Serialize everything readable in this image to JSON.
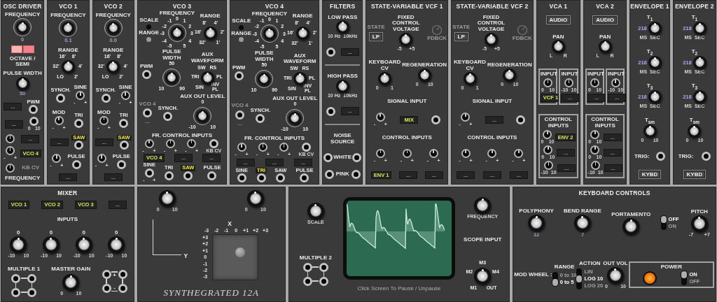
{
  "top_row": [
    {
      "kind": "rack",
      "title": "OSC DRIVER",
      "rows": [
        {
          "items": [
            {
              "kind": "dial",
              "label": "FREQUENCY",
              "value": "0"
            }
          ]
        },
        {
          "items": [
            {
              "kind": "pink"
            }
          ]
        },
        {
          "items": [
            {
              "kind": "text",
              "text": "OCTAVE / SEMI"
            }
          ]
        },
        {
          "items": [
            {
              "kind": "knob",
              "label": "PULSE WIDTH",
              "value": "50"
            }
          ]
        },
        {
          "items": [
            {
              "kind": "tag",
              "text": "...",
              "lit": false
            },
            {
              "kind": "jack",
              "label": "PWM"
            }
          ]
        },
        {
          "items": [
            {
              "kind": "tag",
              "text": "...",
              "lit": false
            },
            {
              "kind": "jack",
              "marks": [
                "0",
                "10"
              ]
            }
          ]
        },
        {
          "items": [
            {
              "kind": "trim"
            },
            {
              "kind": "tag",
              "text": "...",
              "lit": false
            }
          ]
        },
        {
          "items": [
            {
              "kind": "trim",
              "marks": [
                "-",
                "+"
              ]
            },
            {
              "kind": "tag",
              "text": "VCO 4",
              "lit": true
            }
          ]
        },
        {
          "items": [
            {
              "kind": "trim"
            },
            {
              "kind": "text",
              "text": "KB CV",
              "dim": true
            }
          ]
        },
        {
          "items": [
            {
              "kind": "text",
              "text": "FREQUENCY"
            }
          ]
        }
      ]
    },
    {
      "kind": "rack",
      "title": "VCO 1",
      "rows": [
        {
          "items": [
            {
              "kind": "dial",
              "label": "FREQUENCY",
              "value": "0.1"
            }
          ]
        },
        {
          "items": [
            {
              "kind": "knob",
              "label": "RANGE",
              "scale": [
                "LO",
                "32'",
                "16'",
                "8'",
                "4'",
                "2'"
              ]
            }
          ]
        },
        {
          "items": [
            {
              "kind": "jack",
              "label": "SYNCH."
            },
            {
              "kind": "trim",
              "label": "SINE",
              "marks": [
                "-",
                "+"
              ]
            }
          ]
        },
        {
          "items": [
            {
              "kind": "trim",
              "label": "MOD",
              "marks": [
                "-",
                "+"
              ]
            },
            {
              "kind": "jack",
              "label": "TRI"
            }
          ]
        },
        {
          "items": [
            {
              "kind": "tag",
              "text": "...",
              "lit": false
            },
            {
              "kind": "jack",
              "label": "SAW",
              "lit": true
            }
          ]
        },
        {
          "items": [
            {
              "kind": "trim",
              "marks": [
                "-",
                "+"
              ]
            },
            {
              "kind": "jack",
              "label": "PULSE"
            }
          ]
        },
        {
          "items": [
            {
              "kind": "tag",
              "text": "...",
              "lit": false
            }
          ]
        }
      ]
    },
    {
      "kind": "rack",
      "title": "VCO 2",
      "rows": [
        {
          "items": [
            {
              "kind": "dial",
              "label": "FREQUENCY",
              "value": "0.0"
            }
          ]
        },
        {
          "items": [
            {
              "kind": "knob",
              "label": "RANGE",
              "scale": [
                "LO",
                "32'",
                "16'",
                "8'",
                "4'",
                "2'"
              ]
            }
          ]
        },
        {
          "items": [
            {
              "kind": "jack",
              "label": "SYNCH."
            },
            {
              "kind": "trim",
              "label": "SINE",
              "marks": [
                "-",
                "+"
              ]
            }
          ]
        },
        {
          "items": [
            {
              "kind": "trim",
              "label": "MOD",
              "marks": [
                "-",
                "+"
              ]
            },
            {
              "kind": "jack",
              "label": "TRI"
            }
          ]
        },
        {
          "items": [
            {
              "kind": "tag",
              "text": "...",
              "lit": false
            },
            {
              "kind": "jack",
              "label": "SAW",
              "lit": true
            }
          ]
        },
        {
          "items": [
            {
              "kind": "trim",
              "marks": [
                "-",
                "+"
              ]
            },
            {
              "kind": "jack",
              "label": "PULSE"
            }
          ]
        },
        {
          "items": [
            {
              "kind": "tag",
              "text": "...",
              "lit": false
            }
          ]
        }
      ]
    },
    {
      "kind": "rack",
      "title": "VCO 3",
      "rows": [
        {
          "items": [
            {
              "kind": "selector",
              "options": [
                {
                  "label": "SCALE",
                  "selected": false
                },
                {
                  "label": "RANGE",
                  "selected": true
                }
              ]
            },
            {
              "kind": "centerdial",
              "label": "FREQUENCY",
              "scale": [
                "0",
                "1",
                "2",
                "3",
                "4",
                "5",
                "-1",
                "-2",
                "-3",
                "-4",
                "-5"
              ]
            },
            {
              "kind": "knob",
              "label": "RANGE",
              "scale": [
                "32'",
                "16'",
                "8'",
                "4'",
                "2'",
                "1'"
              ]
            }
          ]
        },
        {
          "items": [
            {
              "kind": "jack",
              "label": "PWM"
            },
            {
              "kind": "dial",
              "label": "PULSE WIDTH",
              "scale": [
                "10",
                "50",
                "90"
              ]
            },
            {
              "kind": "knob",
              "label": "AUX WAVEFORM",
              "scale": [
                "SIN",
                "TRI",
                "SW",
                "RS",
                "PL",
                "INV PL"
              ]
            }
          ]
        },
        {
          "items": [
            {
              "kind": "stack",
              "items": [
                {
                  "kind": "text",
                  "text": "VCO 4",
                  "dim": true
                },
                {
                  "kind": "jack"
                },
                {
                  "kind": "text",
                  "text": "...",
                  "dim": true
                }
              ]
            },
            {
              "kind": "jack",
              "label": "SYNCH."
            },
            {
              "kind": "dial",
              "label": "AUX OUT LEVEL",
              "scale": [
                "-10",
                "0",
                "10"
              ]
            }
          ]
        },
        {
          "items": [
            {
              "kind": "text",
              "text": "FR. CONTROL INPUTS"
            }
          ]
        },
        {
          "items": [
            {
              "kind": "trim",
              "marks": [
                "-",
                "+"
              ]
            },
            {
              "kind": "trim",
              "marks": [
                "-",
                "+"
              ]
            },
            {
              "kind": "trim",
              "marks": [
                "-",
                "+"
              ]
            },
            {
              "kind": "jack",
              "marks": [
                "KB CV"
              ]
            }
          ]
        },
        {
          "items": [
            {
              "kind": "tag",
              "text": "VCO 4",
              "lit": true
            },
            {
              "kind": "tag",
              "text": "...",
              "lit": false
            },
            {
              "kind": "tag",
              "text": "...",
              "lit": false
            }
          ]
        },
        {
          "items": [
            {
              "kind": "jack",
              "label": "SINE",
              "marks": [
                "-",
                "+"
              ]
            },
            {
              "kind": "jack",
              "label": "TRI"
            },
            {
              "kind": "jack",
              "label": "SAW",
              "lit": true
            },
            {
              "kind": "jack",
              "label": "PULSE"
            }
          ]
        }
      ]
    },
    {
      "kind": "rack",
      "title": "VCO 4",
      "rows": [
        {
          "items": [
            {
              "kind": "selector",
              "options": [
                {
                  "label": "SCALE",
                  "selected": false
                },
                {
                  "label": "RANGE",
                  "selected": true
                }
              ]
            },
            {
              "kind": "centerdial",
              "label": "FREQUENCY",
              "scale": [
                "0",
                "1",
                "2",
                "3",
                "4",
                "5",
                "-1",
                "-2",
                "-3",
                "-4",
                "-5"
              ]
            },
            {
              "kind": "knob",
              "label": "RANGE",
              "scale": [
                "32'",
                "16'",
                "8'",
                "4'",
                "2'",
                "1'"
              ]
            }
          ]
        },
        {
          "items": [
            {
              "kind": "jack",
              "label": "PWM"
            },
            {
              "kind": "dial",
              "label": "PULSE WIDTH",
              "scale": [
                "10",
                "50",
                "90"
              ]
            },
            {
              "kind": "knob",
              "label": "AUX WAVEFORM",
              "scale": [
                "SIN",
                "TRI",
                "SW",
                "RS",
                "PL",
                "INV PL"
              ]
            }
          ]
        },
        {
          "items": [
            {
              "kind": "stack",
              "items": [
                {
                  "kind": "text",
                  "text": "VCO 4",
                  "dim": true
                },
                {
                  "kind": "jack"
                },
                {
                  "kind": "text",
                  "text": "...",
                  "dim": true
                }
              ]
            },
            {
              "kind": "jack",
              "label": "SYNCH."
            },
            {
              "kind": "dial",
              "label": "AUX OUT LEVEL",
              "scale": [
                "-10",
                "0",
                "10"
              ]
            }
          ]
        },
        {
          "items": [
            {
              "kind": "text",
              "text": "FR. CONTROL INPUTS"
            }
          ]
        },
        {
          "items": [
            {
              "kind": "trim",
              "marks": [
                "-",
                "+"
              ]
            },
            {
              "kind": "trim",
              "marks": [
                "-",
                "+"
              ]
            },
            {
              "kind": "trim",
              "marks": [
                "-",
                "+"
              ]
            },
            {
              "kind": "jack",
              "marks": [
                "KB CV"
              ]
            }
          ]
        },
        {
          "items": [
            {
              "kind": "tag",
              "text": "...",
              "lit": false
            },
            {
              "kind": "tag",
              "text": "...",
              "lit": false
            },
            {
              "kind": "tag",
              "text": "...",
              "lit": false
            }
          ]
        },
        {
          "items": [
            {
              "kind": "jack",
              "label": "SINE"
            },
            {
              "kind": "jack",
              "label": "TRI",
              "lit": true
            },
            {
              "kind": "jack",
              "label": "SAW"
            },
            {
              "kind": "jack",
              "label": "PULSE"
            }
          ]
        }
      ]
    },
    {
      "kind": "rack",
      "title": "FILTERS",
      "rows": [
        {
          "items": [
            {
              "kind": "knob",
              "label": "LOW PASS",
              "marks": [
                "10 Hz",
                "10kHz"
              ]
            }
          ]
        },
        {
          "items": [
            {
              "kind": "jack"
            },
            {
              "kind": "tag",
              "text": "...",
              "lit": false
            }
          ]
        },
        {
          "items": [
            {
              "kind": "rule"
            }
          ]
        },
        {
          "items": [
            {
              "kind": "knob",
              "label": "HIGH PASS",
              "marks": [
                "10 Hz",
                "10kHz"
              ]
            }
          ]
        },
        {
          "items": [
            {
              "kind": "jack"
            },
            {
              "kind": "tag",
              "text": "...",
              "lit": false
            }
          ]
        },
        {
          "items": [
            {
              "kind": "rule"
            }
          ]
        },
        {
          "items": [
            {
              "kind": "text",
              "text": "NOISE SOURCE"
            }
          ]
        },
        {
          "items": [
            {
              "kind": "jack"
            },
            {
              "kind": "text",
              "text": "WHITE"
            },
            {
              "kind": "jack"
            }
          ]
        },
        {
          "items": [
            {
              "kind": "jack"
            },
            {
              "kind": "text",
              "text": "PINK"
            },
            {
              "kind": "jack"
            }
          ]
        }
      ]
    },
    {
      "kind": "rack",
      "title": "STATE-VARIABLE VCF 1",
      "rows": [
        {
          "items": [
            {
              "kind": "stack",
              "items": [
                {
                  "kind": "text",
                  "text": "STATE",
                  "dim": true
                },
                {
                  "kind": "button",
                  "text": "LP"
                }
              ]
            },
            {
              "kind": "knob",
              "label": "FIXED CONTROL VOLTAGE",
              "marks": [
                "-5",
                "+5"
              ]
            },
            {
              "kind": "fdbck",
              "text": "FDBCK"
            }
          ]
        },
        {
          "items": [
            {
              "kind": "knob",
              "label": "KEYBOARD CV",
              "marks": [
                "0",
                "1"
              ]
            },
            {
              "kind": "knob",
              "label": "REGENERATION",
              "marks": [
                "0",
                "10"
              ]
            }
          ]
        },
        {
          "items": [
            {
              "kind": "text",
              "text": "SIGNAL INPUT"
            }
          ]
        },
        {
          "items": [
            {
              "kind": "trim",
              "marks": [
                "-",
                "+"
              ]
            },
            {
              "kind": "tag",
              "text": "MIX",
              "lit": true
            },
            {
              "kind": "jack"
            }
          ]
        },
        {
          "items": [
            {
              "kind": "text",
              "text": "CONTROL INPUTS"
            }
          ]
        },
        {
          "items": [
            {
              "kind": "trim",
              "marks": [
                "-",
                "+"
              ]
            },
            {
              "kind": "trim",
              "marks": [
                "-",
                "+"
              ]
            },
            {
              "kind": "trim",
              "marks": [
                "-",
                "+"
              ]
            }
          ]
        },
        {
          "items": [
            {
              "kind": "tag",
              "text": "ENV 1",
              "lit": true
            },
            {
              "kind": "tag",
              "text": "...",
              "lit": false
            },
            {
              "kind": "tag",
              "text": "...",
              "lit": false
            }
          ]
        }
      ]
    },
    {
      "kind": "rack",
      "title": "STATE-VARIABLE VCF 2",
      "rows": [
        {
          "items": [
            {
              "kind": "stack",
              "items": [
                {
                  "kind": "text",
                  "text": "STATE",
                  "dim": true
                },
                {
                  "kind": "button",
                  "text": "LP"
                }
              ]
            },
            {
              "kind": "knob",
              "label": "FIXED CONTROL VOLTAGE",
              "marks": [
                "-5",
                "+5"
              ]
            },
            {
              "kind": "fdbck",
              "text": "FDBCK"
            }
          ]
        },
        {
          "items": [
            {
              "kind": "knob",
              "label": "KEYBOARD CV",
              "marks": [
                "0",
                "1"
              ]
            },
            {
              "kind": "knob",
              "label": "REGENERATION",
              "marks": [
                "0",
                "10"
              ]
            }
          ]
        },
        {
          "items": [
            {
              "kind": "text",
              "text": "SIGNAL INPUT"
            }
          ]
        },
        {
          "items": [
            {
              "kind": "trim",
              "marks": [
                "-",
                "+"
              ]
            },
            {
              "kind": "tag",
              "text": "...",
              "lit": false
            },
            {
              "kind": "jack"
            }
          ]
        },
        {
          "items": [
            {
              "kind": "text",
              "text": "CONTROL INPUTS"
            }
          ]
        },
        {
          "items": [
            {
              "kind": "trim",
              "marks": [
                "-",
                "+"
              ]
            },
            {
              "kind": "trim",
              "marks": [
                "-",
                "+"
              ]
            },
            {
              "kind": "trim",
              "marks": [
                "-",
                "+"
              ]
            }
          ]
        },
        {
          "items": [
            {
              "kind": "tag",
              "text": "...",
              "lit": false
            },
            {
              "kind": "tag",
              "text": "...",
              "lit": false
            },
            {
              "kind": "tag",
              "text": "...",
              "lit": false
            }
          ]
        }
      ]
    },
    {
      "kind": "rack",
      "title": "VCA 1",
      "rows": [
        {
          "items": [
            {
              "kind": "button",
              "text": "AUDIO"
            }
          ]
        },
        {
          "items": [
            {
              "kind": "knob",
              "label": "PAN",
              "marks": [
                "L",
                "R"
              ]
            }
          ]
        },
        {
          "items": [
            {
              "kind": "box",
              "title": "INPUT",
              "rows": [
                {
                  "items": [
                    {
                      "kind": "trim",
                      "marks": [
                        "0",
                        "10"
                      ]
                    }
                  ]
                },
                {
                  "items": [
                    {
                      "kind": "tag",
                      "text": "VCF 1",
                      "lit": true
                    }
                  ]
                }
              ]
            },
            {
              "kind": "box",
              "title": "INPUT",
              "rows": [
                {
                  "items": [
                    {
                      "kind": "trim",
                      "marks": [
                        "-10",
                        "10"
                      ]
                    }
                  ]
                },
                {
                  "items": [
                    {
                      "kind": "tag",
                      "text": "...",
                      "lit": false
                    }
                  ]
                }
              ]
            }
          ]
        },
        {
          "items": [
            {
              "kind": "box",
              "title": "CONTROL INPUTS",
              "rows": [
                {
                  "items": [
                    {
                      "kind": "trim",
                      "marks": [
                        "0",
                        "10"
                      ]
                    },
                    {
                      "kind": "tag",
                      "text": "ENV 2",
                      "lit": true
                    }
                  ]
                },
                {
                  "items": [
                    {
                      "kind": "trim",
                      "marks": [
                        "0",
                        "10"
                      ]
                    },
                    {
                      "kind": "tag",
                      "text": "...",
                      "lit": false
                    }
                  ]
                },
                {
                  "items": [
                    {
                      "kind": "trim",
                      "marks": [
                        "-10",
                        "10"
                      ]
                    },
                    {
                      "kind": "tag",
                      "text": "...",
                      "lit": false
                    }
                  ]
                }
              ]
            }
          ]
        }
      ]
    },
    {
      "kind": "rack",
      "title": "VCA 2",
      "rows": [
        {
          "items": [
            {
              "kind": "button",
              "text": "AUDIO"
            }
          ]
        },
        {
          "items": [
            {
              "kind": "knob",
              "label": "PAN",
              "marks": [
                "L",
                "R"
              ]
            }
          ]
        },
        {
          "items": [
            {
              "kind": "box",
              "title": "INPUT",
              "rows": [
                {
                  "items": [
                    {
                      "kind": "trim",
                      "marks": [
                        "0",
                        "10"
                      ]
                    }
                  ]
                },
                {
                  "items": [
                    {
                      "kind": "tag",
                      "text": "...",
                      "lit": false
                    }
                  ]
                }
              ]
            },
            {
              "kind": "box",
              "title": "INPUT",
              "rows": [
                {
                  "items": [
                    {
                      "kind": "trim",
                      "marks": [
                        "-10",
                        "10"
                      ]
                    }
                  ]
                },
                {
                  "items": [
                    {
                      "kind": "tag",
                      "text": "...",
                      "lit": false
                    }
                  ]
                }
              ]
            }
          ]
        },
        {
          "items": [
            {
              "kind": "box",
              "title": "CONTROL INPUTS",
              "rows": [
                {
                  "items": [
                    {
                      "kind": "trim",
                      "marks": [
                        "0",
                        "10"
                      ]
                    },
                    {
                      "kind": "tag",
                      "text": "...",
                      "lit": false
                    }
                  ]
                },
                {
                  "items": [
                    {
                      "kind": "trim",
                      "marks": [
                        "0",
                        "10"
                      ]
                    },
                    {
                      "kind": "tag",
                      "text": "...",
                      "lit": false
                    }
                  ]
                },
                {
                  "items": [
                    {
                      "kind": "trim",
                      "marks": [
                        "-10",
                        "10"
                      ]
                    },
                    {
                      "kind": "tag",
                      "text": "...",
                      "lit": false
                    }
                  ]
                }
              ]
            }
          ]
        }
      ]
    },
    {
      "kind": "rack",
      "title": "ENVELOPE 1",
      "rows": [
        {
          "items": [
            {
              "kind": "knob",
              "label": "T$_{1}$",
              "reading": "218",
              "marks": [
                "MS",
                "SEC"
              ]
            }
          ]
        },
        {
          "items": [
            {
              "kind": "knob",
              "label": "T$_{2}$",
              "reading": "218",
              "marks": [
                "MS",
                "SEC"
              ]
            }
          ]
        },
        {
          "items": [
            {
              "kind": "knob",
              "label": "T$_{3}$",
              "reading": "218",
              "marks": [
                "MS",
                "SEC"
              ]
            }
          ]
        },
        {
          "items": [
            {
              "kind": "knob",
              "label": "T$_{sm}$",
              "marks": [
                "0",
                "10"
              ]
            }
          ]
        },
        {
          "items": [
            {
              "kind": "text",
              "text": "TRIG:"
            },
            {
              "kind": "jack"
            }
          ]
        },
        {
          "items": [
            {
              "kind": "button",
              "text": "KYBD"
            }
          ]
        }
      ]
    },
    {
      "kind": "rack",
      "title": "ENVELOPE 2",
      "rows": [
        {
          "items": [
            {
              "kind": "knob",
              "label": "T$_{1}$",
              "reading": "218",
              "marks": [
                "MS",
                "SEC"
              ]
            }
          ]
        },
        {
          "items": [
            {
              "kind": "knob",
              "label": "T$_{2}$",
              "reading": "218",
              "marks": [
                "MS",
                "SEC"
              ]
            }
          ]
        },
        {
          "items": [
            {
              "kind": "knob",
              "label": "T$_{3}$",
              "reading": "218",
              "marks": [
                "MS",
                "SEC"
              ]
            }
          ]
        },
        {
          "items": [
            {
              "kind": "knob",
              "label": "T$_{sm}$",
              "marks": [
                "0",
                "10"
              ]
            }
          ]
        },
        {
          "items": [
            {
              "kind": "text",
              "text": "TRIG:"
            },
            {
              "kind": "jack"
            }
          ]
        },
        {
          "items": [
            {
              "kind": "button",
              "text": "KYBD"
            }
          ]
        }
      ]
    }
  ],
  "bottom_row": [
    {
      "kind": "rack",
      "title": "MIXER",
      "rows": [
        {
          "items": [
            {
              "kind": "tag",
              "text": "VCO 1",
              "lit": true
            },
            {
              "kind": "tag",
              "text": "VCO 2",
              "lit": true
            },
            {
              "kind": "tag",
              "text": "VCO 3",
              "lit": true
            },
            {
              "kind": "tag",
              "text": "...",
              "lit": false
            }
          ]
        },
        {
          "items": [
            {
              "kind": "text",
              "text": "INPUTS"
            }
          ]
        },
        {
          "items": [
            {
              "kind": "knob",
              "label": "0",
              "marks": [
                "-10",
                "10"
              ]
            },
            {
              "kind": "knob",
              "label": "0",
              "marks": [
                "-10",
                "10"
              ]
            },
            {
              "kind": "knob",
              "label": "0",
              "marks": [
                "-10",
                "10"
              ]
            },
            {
              "kind": "knob",
              "label": "0",
              "marks": [
                "-10",
                "10"
              ]
            }
          ]
        },
        {
          "items": [
            {
              "kind": "stack",
              "items": [
                {
                  "kind": "text",
                  "text": "MULTIPLE 1"
                },
                {
                  "kind": "jacks4"
                }
              ]
            },
            {
              "kind": "stack",
              "items": [
                {
                  "kind": "text",
                  "text": "MASTER GAIN"
                },
                {
                  "kind": "knob",
                  "marks": [
                    "0",
                    "10"
                  ]
                }
              ]
            },
            {
              "kind": "jacks4",
              "signs": [
                "+",
                "-"
              ]
            }
          ]
        }
      ]
    },
    {
      "kind": "xy",
      "knobs": [
        {
          "kind": "knob",
          "marks": [
            "0",
            "10"
          ]
        },
        {
          "kind": "knob",
          "marks": [
            "0",
            "10"
          ]
        }
      ],
      "x_label": "X",
      "y_label": "Y",
      "x_ticks": [
        "-3",
        "-2",
        "-1",
        "0",
        "+1",
        "+2",
        "+3"
      ],
      "y_ticks": [
        "+3",
        "+2",
        "+1",
        "0",
        "-1",
        "-2",
        "-3"
      ],
      "logo": "SYNTHEGRATED 12A"
    },
    {
      "kind": "scope",
      "left": [
        {
          "kind": "knob",
          "marks": [
            "SCALE"
          ]
        },
        {
          "kind": "stack",
          "items": [
            {
              "kind": "text",
              "text": "MULTIPLE 2"
            },
            {
              "kind": "jacks4"
            }
          ]
        }
      ],
      "right": [
        {
          "kind": "knob",
          "marks": [
            "FREQUENCY"
          ]
        },
        {
          "kind": "text",
          "text": "SCOPE INPUT"
        },
        {
          "kind": "knob",
          "scale": [
            "M1",
            "M2",
            "M3",
            "M4",
            "OUT"
          ]
        }
      ],
      "caption": "Click Screen To Pause / Unpause"
    },
    {
      "kind": "rack",
      "title": "KEYBOARD CONTROLS",
      "rows": [
        {
          "items": [
            {
              "kind": "knob",
              "label": "POLYPHONY",
              "value": "12"
            },
            {
              "kind": "knob",
              "label": "BEND RANGE",
              "value": "7"
            },
            {
              "kind": "knob",
              "label": "PORTAMENTO"
            },
            {
              "kind": "toggle",
              "options": [
                {
                  "label": "OFF",
                  "selected": true
                },
                {
                  "label": "ON",
                  "selected": false
                }
              ]
            },
            {
              "kind": "knob",
              "label": "PITCH",
              "marks": [
                "-7",
                "+7"
              ]
            }
          ]
        },
        {
          "items": [
            {
              "kind": "text",
              "text": "MOD WHEEL :"
            },
            {
              "kind": "stack",
              "items": [
                {
                  "kind": "text",
                  "text": "RANGE"
                },
                {
                  "kind": "toggle",
                  "options": [
                    {
                      "label": "0 to 10",
                      "selected": false
                    },
                    {
                      "label": "0 to 5",
                      "selected": true
                    }
                  ]
                }
              ]
            },
            {
              "kind": "stack",
              "items": [
                {
                  "kind": "text",
                  "text": "ACTION"
                },
                {
                  "kind": "toggle",
                  "options": [
                    {
                      "label": "LIN",
                      "selected": false
                    },
                    {
                      "label": "LOG 10",
                      "selected": true
                    },
                    {
                      "label": "LOG 20",
                      "selected": false
                    }
                  ]
                }
              ]
            },
            {
              "kind": "knob",
              "label": "OUT VOL",
              "marks": [
                "0",
                "10"
              ]
            },
            {
              "kind": "box",
              "title": "POWER",
              "rows": [
                {
                  "items": [
                    {
                      "kind": "lamp",
                      "on": true
                    },
                    {
                      "kind": "toggle",
                      "options": [
                        {
                          "label": "ON",
                          "selected": true
                        },
                        {
                          "label": "OFF",
                          "selected": false
                        }
                      ]
                    }
                  ]
                }
              ]
            }
          ]
        }
      ]
    }
  ]
}
